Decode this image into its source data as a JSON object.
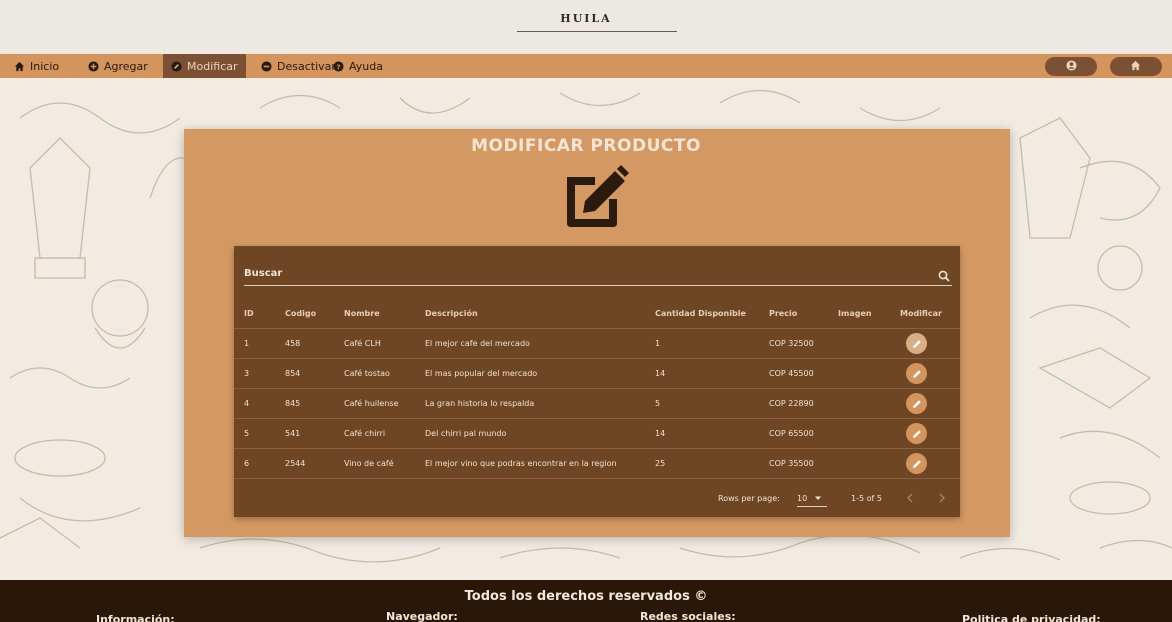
{
  "brand": "HUILA",
  "nav": {
    "items": [
      {
        "label": "Inicio",
        "icon": "home-icon"
      },
      {
        "label": "Agregar",
        "icon": "plus-circle-icon"
      },
      {
        "label": "Modificar",
        "icon": "edit-circle-icon"
      },
      {
        "label": "Desactivar",
        "icon": "minus-circle-icon"
      },
      {
        "label": "Ayuda",
        "icon": "help-circle-icon"
      }
    ],
    "active": "Modificar",
    "right_buttons": [
      {
        "icon": "user-icon"
      },
      {
        "icon": "home-alt-icon"
      }
    ]
  },
  "main": {
    "title": "MODIFICAR PRODUCTO",
    "icon": "edit-square-icon"
  },
  "table": {
    "search_label": "Buscar",
    "columns": [
      "ID",
      "Codigo",
      "Nombre",
      "Descripción",
      "Cantidad Disponible",
      "Precio",
      "Imagen",
      "Modificar"
    ],
    "rows": [
      {
        "id": "1",
        "codigo": "458",
        "nombre": "Café CLH",
        "descripcion": "El mejor cafe del mercado",
        "cantidad": "1",
        "precio": "COP 32500"
      },
      {
        "id": "3",
        "codigo": "854",
        "nombre": "Café tostao",
        "descripcion": "El mas popular del mercado",
        "cantidad": "14",
        "precio": "COP 45500"
      },
      {
        "id": "4",
        "codigo": "845",
        "nombre": "Café huilense",
        "descripcion": "La gran historia lo respalda",
        "cantidad": "5",
        "precio": "COP 22890"
      },
      {
        "id": "5",
        "codigo": "541",
        "nombre": "Café chirri",
        "descripcion": "Del chirri pal mundo",
        "cantidad": "14",
        "precio": "COP 65500"
      },
      {
        "id": "6",
        "codigo": "2544",
        "nombre": "Vino de café",
        "descripcion": "El mejor vino que podras encontrar en la region",
        "cantidad": "25",
        "precio": "COP 35500"
      }
    ],
    "pagination": {
      "rows_per_page_label": "Rows per page:",
      "rows_per_page": "10",
      "range": "1-5 of 5"
    }
  },
  "footer": {
    "title": "Todos los derechos reservados ©",
    "columns": [
      "Información:",
      "Navegador:",
      "Redes sociales:",
      "Politica de privacidad:"
    ]
  },
  "colors": {
    "nav": "#d4945e",
    "nav_active": "#7b5033",
    "card": "#d49962",
    "panel": "#6e4624",
    "footer": "#2b1708"
  }
}
